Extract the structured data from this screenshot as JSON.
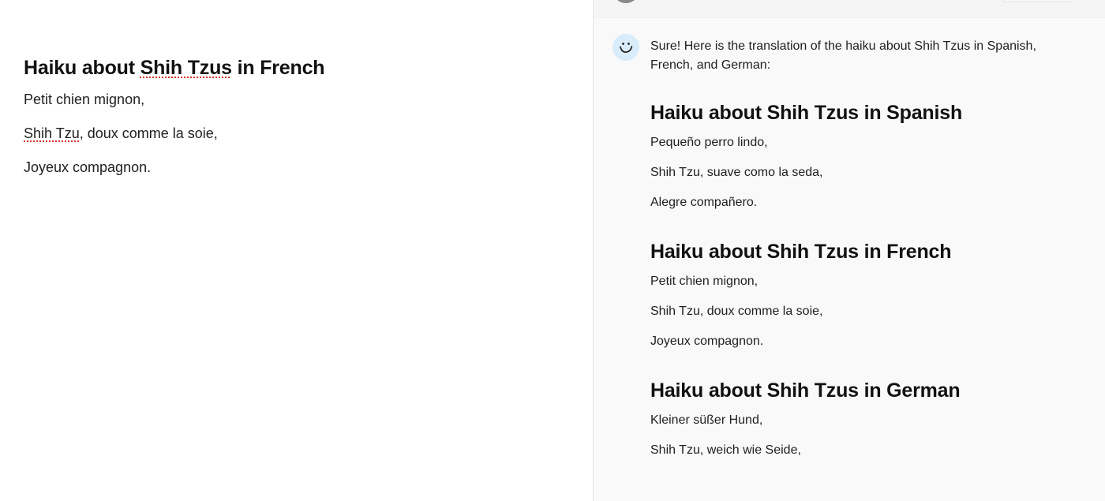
{
  "document": {
    "title": "Haiku about Shih Tzus in French",
    "title_prefix": "Haiku about ",
    "title_flagged": "Shih Tzus",
    "title_suffix": " in French",
    "lines": [
      {
        "flagged": "",
        "text": "Petit chien mignon,"
      },
      {
        "flagged": "Shih Tzu",
        "text": ", doux comme la soie,"
      },
      {
        "flagged": "",
        "text": "Joyeux compagnon."
      }
    ]
  },
  "chat": {
    "intro": "Sure! Here is the translation of the haiku about Shih Tzus in Spanish, French, and German:",
    "sections": [
      {
        "title": "Haiku about Shih Tzus in Spanish",
        "lines": [
          "Pequeño perro lindo,",
          "Shih Tzu, suave como la seda,",
          "Alegre compañero."
        ]
      },
      {
        "title": "Haiku about Shih Tzus in French",
        "lines": [
          "Petit chien mignon,",
          "Shih Tzu, doux comme la soie,",
          "Joyeux compagnon."
        ]
      },
      {
        "title": "Haiku about Shih Tzus in German",
        "lines": [
          "Kleiner süßer Hund,",
          "Shih Tzu, weich wie Seide,"
        ]
      }
    ]
  },
  "icons": {
    "assistant_avatar": "smiley-face-icon",
    "user_avatar": "avatar-icon"
  },
  "colors": {
    "chat_background": "#f9f9f9",
    "avatar_background": "#d9ecfb",
    "spellcheck_underline": "#d93025"
  }
}
